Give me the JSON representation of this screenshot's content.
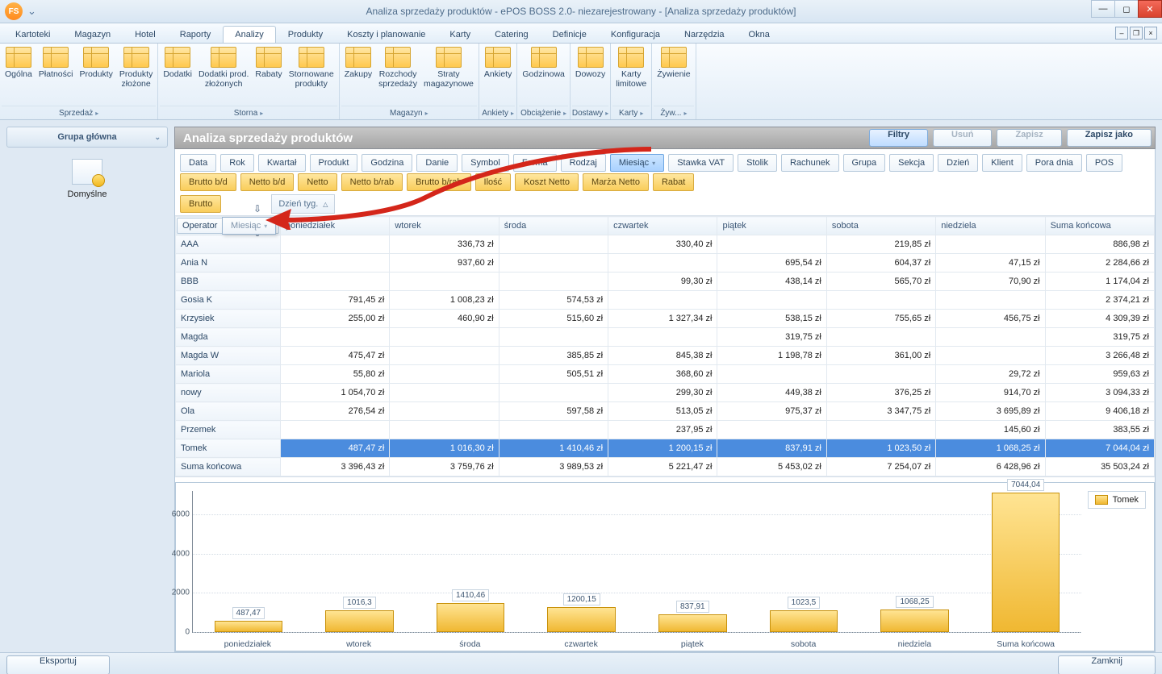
{
  "window": {
    "title": "Analiza sprzedaży produktów - ePOS BOSS 2.0- niezarejestrowany - [Analiza sprzedaży produktów]",
    "logo": "FS"
  },
  "menu": {
    "tabs": [
      "Kartoteki",
      "Magazyn",
      "Hotel",
      "Raporty",
      "Analizy",
      "Produkty",
      "Koszty i planowanie",
      "Karty",
      "Catering",
      "Definicje",
      "Konfiguracja",
      "Narzędzia",
      "Okna"
    ],
    "active": "Analizy"
  },
  "ribbon": [
    {
      "label": "Sprzedaż",
      "items": [
        "Ogólna",
        "Płatności",
        "Produkty",
        "Produkty\nzłożone"
      ]
    },
    {
      "label": "Storna",
      "items": [
        "Dodatki",
        "Dodatki prod.\nzłożonych",
        "Rabaty",
        "Stornowane\nprodukty"
      ]
    },
    {
      "label": "Magazyn",
      "items": [
        "Zakupy",
        "Rozchody\nsprzedaży",
        "Straty\nmagazynowe"
      ]
    },
    {
      "label": "Ankiety",
      "items": [
        "Ankiety"
      ]
    },
    {
      "label": "Obciążenie",
      "items": [
        "Godzinowa"
      ]
    },
    {
      "label": "Dostawy",
      "items": [
        "Dowozy"
      ]
    },
    {
      "label": "Karty",
      "items": [
        "Karty\nlimitowe"
      ]
    },
    {
      "label": "Żyw...",
      "items": [
        "Żywienie"
      ]
    }
  ],
  "sidebar": {
    "title": "Grupa główna",
    "item": "Domyślne"
  },
  "page": {
    "title": "Analiza sprzedaży produktów",
    "buttons": {
      "filters": "Filtry",
      "delete": "Usuń",
      "save": "Zapisz",
      "saveas": "Zapisz jako"
    }
  },
  "filters": {
    "row1": [
      "Data",
      "Rok",
      "Kwartał",
      "Produkt",
      "Godzina",
      "Danie",
      "Symbol",
      "Forma",
      "Rodzaj",
      "Miesiąc",
      "Stawka VAT",
      "Stolik",
      "Rachunek",
      "Grupa",
      "Sekcja",
      "Dzień",
      "Klient",
      "Pora dnia",
      "POS"
    ],
    "row2": [
      "Brutto b/d",
      "Netto b/d",
      "Netto",
      "Netto b/rab",
      "Brutto b/rab",
      "Ilość",
      "Koszt Netto",
      "Marża Netto",
      "Rabat"
    ],
    "group": {
      "measure": "Brutto",
      "by": "Dzień tyg.",
      "operator": "Operator",
      "ghost": "Miesiąc"
    }
  },
  "table": {
    "cols": [
      "Operator",
      "poniedziałek",
      "wtorek",
      "środa",
      "czwartek",
      "piątek",
      "sobota",
      "niedziela",
      "Suma końcowa"
    ],
    "rows": [
      {
        "n": "AAA",
        "v": [
          "",
          "336,73 zł",
          "",
          "330,40 zł",
          "",
          "219,85 zł",
          "",
          "886,98 zł"
        ]
      },
      {
        "n": "Ania N",
        "v": [
          "",
          "937,60 zł",
          "",
          "",
          "695,54 zł",
          "604,37 zł",
          "47,15 zł",
          "2 284,66 zł"
        ]
      },
      {
        "n": "BBB",
        "v": [
          "",
          "",
          "",
          "99,30 zł",
          "438,14 zł",
          "565,70 zł",
          "70,90 zł",
          "1 174,04 zł"
        ]
      },
      {
        "n": "Gosia K",
        "v": [
          "791,45 zł",
          "1 008,23 zł",
          "574,53 zł",
          "",
          "",
          "",
          "",
          "2 374,21 zł"
        ]
      },
      {
        "n": "Krzysiek",
        "v": [
          "255,00 zł",
          "460,90 zł",
          "515,60 zł",
          "1 327,34 zł",
          "538,15 zł",
          "755,65 zł",
          "456,75 zł",
          "4 309,39 zł"
        ]
      },
      {
        "n": "Magda",
        "v": [
          "",
          "",
          "",
          "",
          "319,75 zł",
          "",
          "",
          "319,75 zł"
        ]
      },
      {
        "n": "Magda W",
        "v": [
          "475,47 zł",
          "",
          "385,85 zł",
          "845,38 zł",
          "1 198,78 zł",
          "361,00 zł",
          "",
          "3 266,48 zł"
        ]
      },
      {
        "n": "Mariola",
        "v": [
          "55,80 zł",
          "",
          "505,51 zł",
          "368,60 zł",
          "",
          "",
          "29,72 zł",
          "959,63 zł"
        ]
      },
      {
        "n": "nowy",
        "v": [
          "1 054,70 zł",
          "",
          "",
          "299,30 zł",
          "449,38 zł",
          "376,25 zł",
          "914,70 zł",
          "3 094,33 zł"
        ]
      },
      {
        "n": "Ola",
        "v": [
          "276,54 zł",
          "",
          "597,58 zł",
          "513,05 zł",
          "975,37 zł",
          "3 347,75 zł",
          "3 695,89 zł",
          "9 406,18 zł"
        ]
      },
      {
        "n": "Przemek",
        "v": [
          "",
          "",
          "",
          "237,95 zł",
          "",
          "",
          "145,60 zł",
          "383,55 zł"
        ]
      },
      {
        "n": "Tomek",
        "hl": true,
        "v": [
          "487,47 zł",
          "1 016,30 zł",
          "1 410,46 zł",
          "1 200,15 zł",
          "837,91 zł",
          "1 023,50 zł",
          "1 068,25 zł",
          "7 044,04 zł"
        ]
      },
      {
        "n": "Suma końcowa",
        "v": [
          "3 396,43 zł",
          "3 759,76 zł",
          "3 989,53 zł",
          "5 221,47 zł",
          "5 453,02 zł",
          "7 254,07 zł",
          "6 428,96 zł",
          "35 503,24 zł"
        ]
      }
    ]
  },
  "chart_data": {
    "type": "bar",
    "categories": [
      "poniedziałek",
      "wtorek",
      "środa",
      "czwartek",
      "piątek",
      "sobota",
      "niedziela",
      "Suma końcowa"
    ],
    "values": [
      487.47,
      1016.3,
      1410.46,
      1200.15,
      837.91,
      1023.5,
      1068.25,
      7044.04
    ],
    "labels": [
      "487,47",
      "1016,3",
      "1410,46",
      "1200,15",
      "837,91",
      "1023,5",
      "1068,25",
      "7044,04"
    ],
    "series_name": "Tomek",
    "ylim": [
      0,
      7200
    ],
    "yticks": [
      0,
      2000,
      4000,
      6000
    ]
  },
  "footer": {
    "export": "Eksportuj",
    "close": "Zamknij"
  }
}
